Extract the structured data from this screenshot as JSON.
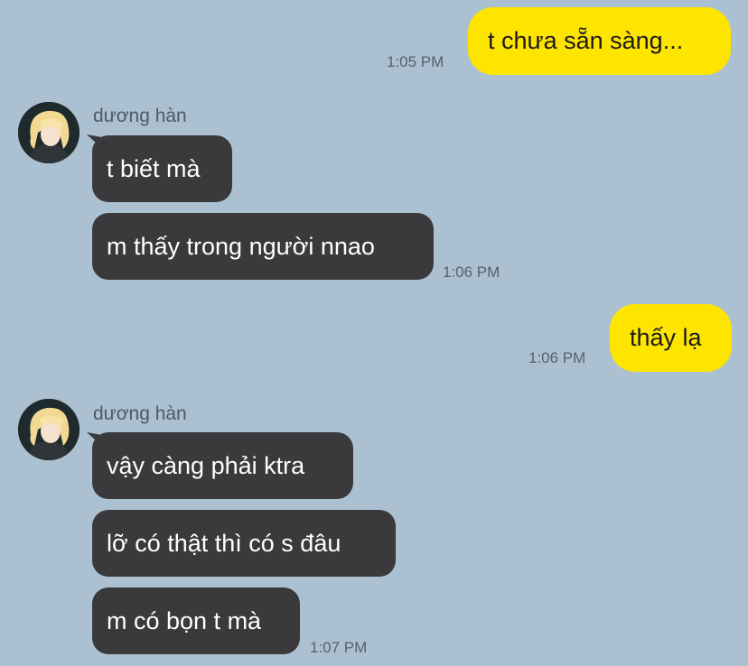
{
  "colors": {
    "background": "#abc1d1",
    "my_bubble": "#fee500",
    "their_bubble": "#3a3a3c"
  },
  "messages": {
    "m1": {
      "text": "t chưa sẵn sàng...",
      "time": "1:05 PM"
    },
    "g1": {
      "sender": "dương hàn",
      "avatar_icon": "profile-photo-icon",
      "b1": "t biết mà",
      "b2": "m thấy trong người nnao",
      "time": "1:06 PM"
    },
    "m2": {
      "text": "thấy lạ",
      "time": "1:06 PM"
    },
    "g2": {
      "sender": "dương hàn",
      "avatar_icon": "profile-photo-icon",
      "b1": "vậy càng phải ktra",
      "b2": "lỡ có thật thì có s đâu",
      "b3": "m có bọn t mà",
      "time": "1:07 PM"
    }
  }
}
